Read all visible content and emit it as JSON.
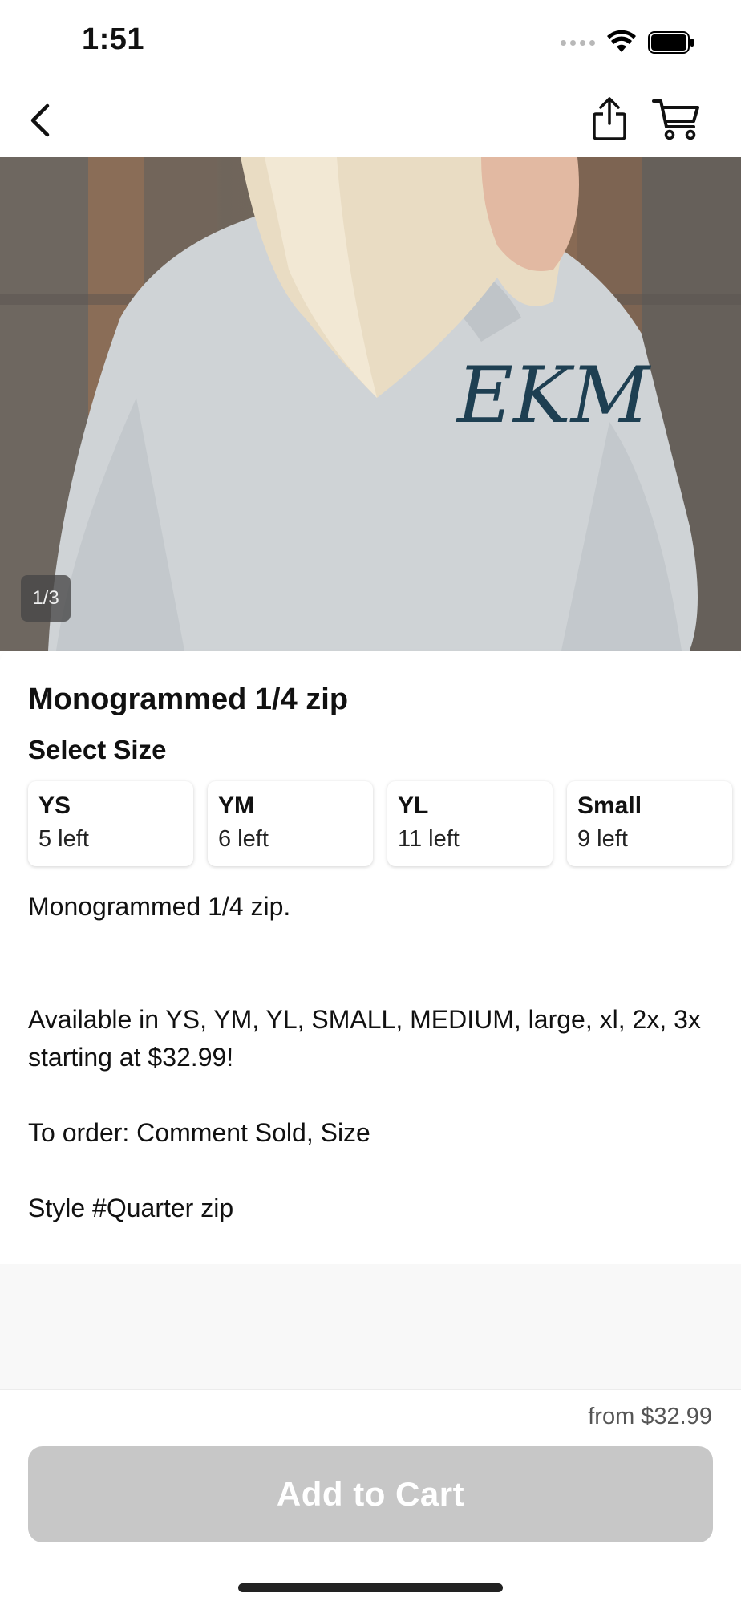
{
  "status_bar": {
    "time": "1:51"
  },
  "nav": {
    "back_icon": "chevron-left-icon",
    "share_icon": "share-icon",
    "cart_icon": "cart-icon"
  },
  "gallery": {
    "counter": "1/3",
    "image_description_icon": "product-photo"
  },
  "product": {
    "title": "Monogrammed 1/4 zip",
    "select_size_label": "Select Size",
    "sizes": [
      {
        "name": "YS",
        "stock": "5 left"
      },
      {
        "name": "YM",
        "stock": "6 left"
      },
      {
        "name": "YL",
        "stock": "11 left"
      },
      {
        "name": "Small",
        "stock": "9 left"
      }
    ],
    "description": {
      "line1": "Monogrammed 1/4 zip.",
      "line2": "Available in YS, YM, YL, SMALL, MEDIUM, large, xl, 2x, 3x starting at $32.99!",
      "line3": "To order: Comment Sold, Size",
      "line4": "Style #Quarter zip"
    }
  },
  "purchase": {
    "price": "from $32.99",
    "add_to_cart_label": "Add to Cart",
    "button_color": "#c7c7c7"
  }
}
